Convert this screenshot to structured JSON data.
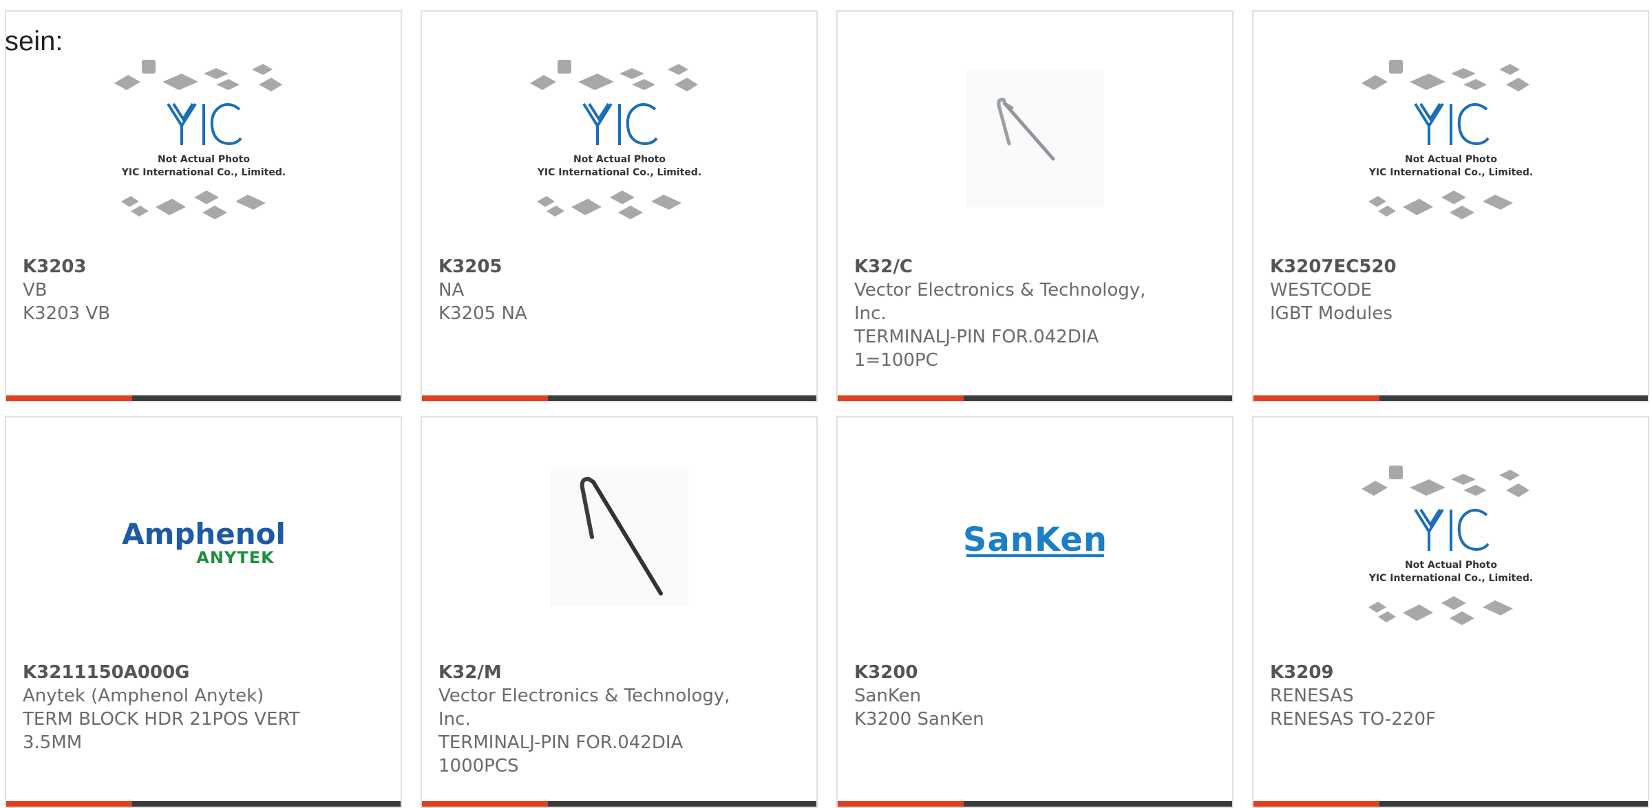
{
  "page": {
    "prefix_text": "sein:"
  },
  "colors": {
    "accent": "#e0401c",
    "bar": "#3b3b3b",
    "border": "#e1e1e1",
    "text": "#6b6b6b"
  },
  "cards": [
    {
      "part": "K3203",
      "brand": "VB",
      "desc": "K3203 VB",
      "image": "yic-placeholder",
      "placeholder": {
        "line1": "Not Actual Photo",
        "line2": "YIC International Co., Limited."
      }
    },
    {
      "part": "K3205",
      "brand": "NA",
      "desc": "K3205 NA",
      "image": "yic-placeholder",
      "placeholder": {
        "line1": "Not Actual Photo",
        "line2": "YIC International Co., Limited."
      }
    },
    {
      "part": "K32/C",
      "brand": "Vector Electronics & Technology, Inc.",
      "desc": "TERMINALJ-PIN FOR.042DIA 1=100PC",
      "image": "j-pin-light"
    },
    {
      "part": "K3207EC520",
      "brand": "WESTCODE",
      "desc": "IGBT Modules",
      "image": "yic-placeholder",
      "placeholder": {
        "line1": "Not Actual Photo",
        "line2": "YIC International Co., Limited."
      }
    },
    {
      "part": "K3211150A000G",
      "brand": "Anytek (Amphenol Anytek)",
      "desc": "TERM BLOCK HDR 21POS VERT 3.5MM",
      "image": "amphenol-logo",
      "logo": {
        "top": "Amphenol",
        "bottom": "ANYTEK"
      }
    },
    {
      "part": "K32/M",
      "brand": "Vector Electronics & Technology, Inc.",
      "desc": "TERMINALJ-PIN FOR.042DIA 1000PCS",
      "image": "j-pin-dark"
    },
    {
      "part": "K3200",
      "brand": "SanKen",
      "desc": "K3200 SanKen",
      "image": "sanken-logo",
      "logo": {
        "text": "SanKen"
      }
    },
    {
      "part": "K3209",
      "brand": "RENESAS",
      "desc": "RENESAS TO-220F",
      "image": "yic-placeholder",
      "placeholder": {
        "line1": "Not Actual Photo",
        "line2": "YIC International Co., Limited."
      }
    }
  ]
}
